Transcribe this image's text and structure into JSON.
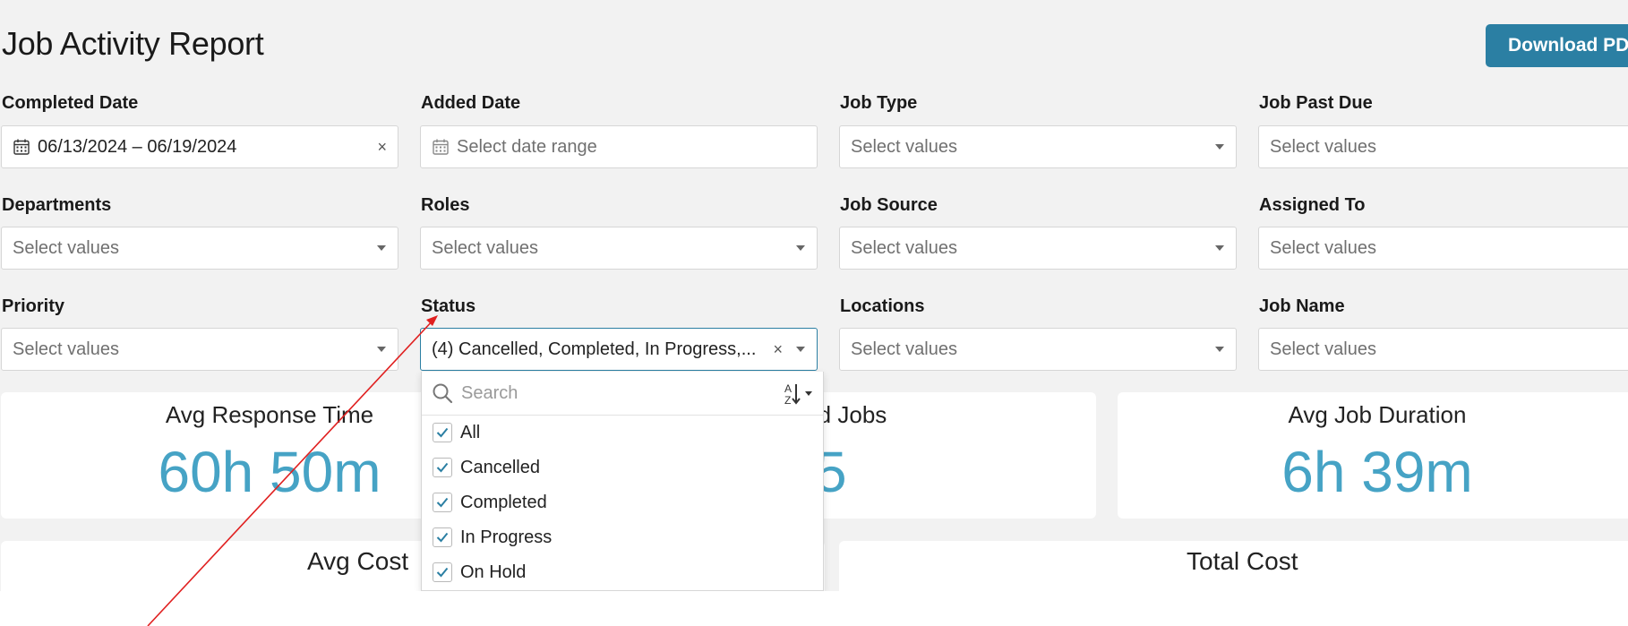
{
  "header": {
    "title": "Job Activity Report",
    "download_label": "Download PDF"
  },
  "filters": {
    "completed_date": {
      "label": "Completed Date",
      "value": "06/13/2024 – 06/19/2024",
      "clear": "×"
    },
    "added_date": {
      "label": "Added Date",
      "placeholder": "Select date range"
    },
    "job_type": {
      "label": "Job Type",
      "placeholder": "Select values"
    },
    "job_past_due": {
      "label": "Job Past Due",
      "placeholder": "Select values"
    },
    "departments": {
      "label": "Departments",
      "placeholder": "Select values"
    },
    "roles": {
      "label": "Roles",
      "placeholder": "Select values"
    },
    "job_source": {
      "label": "Job Source",
      "placeholder": "Select values"
    },
    "assigned_to": {
      "label": "Assigned To",
      "placeholder": "Select values"
    },
    "priority": {
      "label": "Priority",
      "placeholder": "Select values"
    },
    "status": {
      "label": "Status",
      "value": "(4) Cancelled, Completed, In Progress,...",
      "clear": "×"
    },
    "locations": {
      "label": "Locations",
      "placeholder": "Select values"
    },
    "job_name": {
      "label": "Job Name",
      "placeholder": "Select values"
    }
  },
  "status_dropdown": {
    "search_placeholder": "Search",
    "sort_icon": "sort-az-icon",
    "options": [
      {
        "label": "All",
        "checked": true
      },
      {
        "label": "Cancelled",
        "checked": true
      },
      {
        "label": "Completed",
        "checked": true
      },
      {
        "label": "In Progress",
        "checked": true
      },
      {
        "label": "On Hold",
        "checked": true
      }
    ]
  },
  "metrics": {
    "avg_response_time": {
      "title": "Avg Response Time",
      "value": "60h 50m"
    },
    "completed_jobs": {
      "title_visible": "ted Jobs",
      "value_visible": "5"
    },
    "avg_job_duration": {
      "title": "Avg Job Duration",
      "value": "6h 39m"
    },
    "avg_cost": {
      "title": "Avg Cost"
    },
    "total_cost": {
      "title": "Total Cost"
    }
  },
  "colors": {
    "accent": "#2b7fa3",
    "metric_value": "#46a3c5",
    "background": "#f2f2f2",
    "annotation_line": "#e02020"
  }
}
